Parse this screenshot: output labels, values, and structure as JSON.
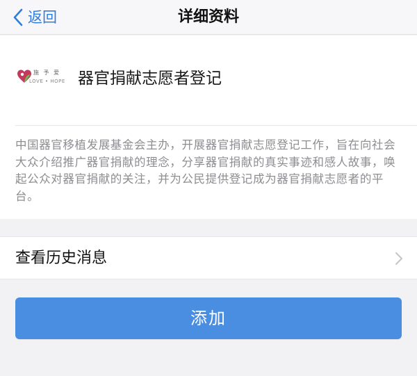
{
  "colors": {
    "accent": "#2f7ce0",
    "button": "#4a8ee2",
    "background": "#f2f2f5",
    "logo_red": "#c43a5c",
    "logo_green": "#6dbf4a"
  },
  "navbar": {
    "back_label": "返回",
    "title": "详细资料"
  },
  "account": {
    "logo_cn_text": "施 予 爱",
    "logo_en_text": "LOVE • HOPE",
    "name": "器官捐献志愿者登记"
  },
  "description": "中国器官移植发展基金会主办，开展器官捐献志愿登记工作，旨在向社会大众介绍推广器官捐献的理念，分享器官捐献的真实事迹和感人故事，唤起公众对器官捐献的关注，并为公民提供登记成为器官捐献志愿者的平台。",
  "history": {
    "label": "查看历史消息"
  },
  "add_button": {
    "label": "添加"
  }
}
